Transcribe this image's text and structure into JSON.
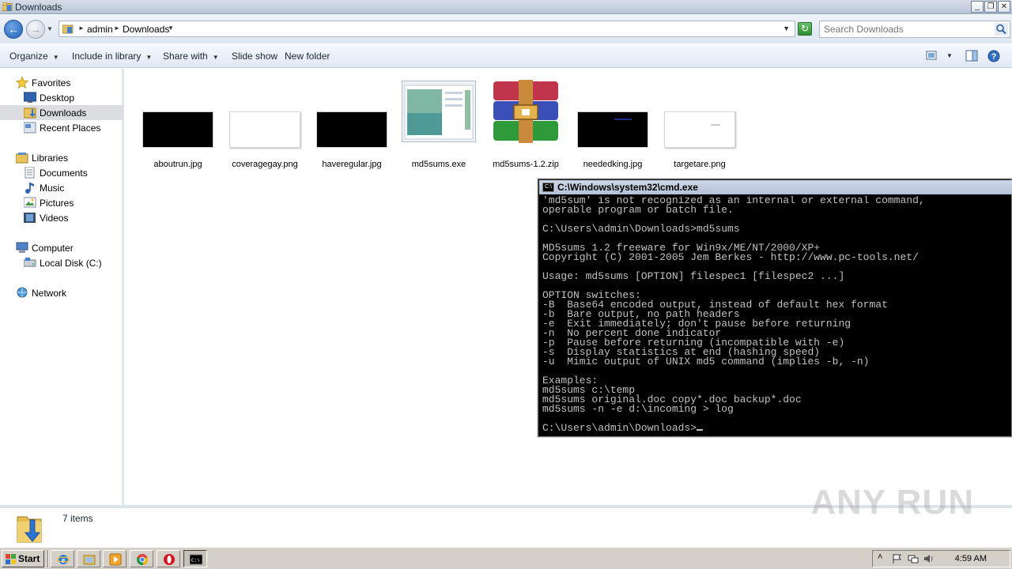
{
  "window": {
    "title": "Downloads",
    "buttons": {
      "minimize": "_",
      "restore": "❐",
      "close": "✕"
    }
  },
  "address": {
    "crumbs": [
      "admin",
      "Downloads"
    ],
    "search_placeholder": "Search Downloads"
  },
  "toolbar": {
    "organize": "Organize",
    "include_library": "Include in library",
    "share_with": "Share with",
    "slide_show": "Slide show",
    "new_folder": "New folder"
  },
  "nav": {
    "favorites": "Favorites",
    "desktop": "Desktop",
    "downloads": "Downloads",
    "recent_places": "Recent Places",
    "libraries": "Libraries",
    "documents": "Documents",
    "music": "Music",
    "pictures": "Pictures",
    "videos": "Videos",
    "computer": "Computer",
    "local_disk": "Local Disk (C:)",
    "network": "Network"
  },
  "files": [
    {
      "name": "aboutrun.jpg",
      "kind": "black-image"
    },
    {
      "name": "coveragegay.png",
      "kind": "white-image"
    },
    {
      "name": "haveregular.jpg",
      "kind": "black-image"
    },
    {
      "name": "md5sums.exe",
      "kind": "exe"
    },
    {
      "name": "md5sums-1.2.zip",
      "kind": "winrar-archive"
    },
    {
      "name": "neededking.jpg",
      "kind": "black-image"
    },
    {
      "name": "targetare.png",
      "kind": "white-image"
    }
  ],
  "status": {
    "item_count": "7 items"
  },
  "watermark": "ANY RUN",
  "cmd": {
    "title": "C:\\Windows\\system32\\cmd.exe",
    "lines": [
      "'md5sum' is not recognized as an internal or external command,",
      "operable program or batch file.",
      "",
      "C:\\Users\\admin\\Downloads>md5sums",
      "",
      "MD5sums 1.2 freeware for Win9x/ME/NT/2000/XP+",
      "Copyright (C) 2001-2005 Jem Berkes - http://www.pc-tools.net/",
      "",
      "Usage: md5sums [OPTION] filespec1 [filespec2 ...]",
      "",
      "OPTION switches:",
      "-B  Base64 encoded output, instead of default hex format",
      "-b  Bare output, no path headers",
      "-e  Exit immediately; don't pause before returning",
      "-n  No percent done indicator",
      "-p  Pause before returning (incompatible with -e)",
      "-s  Display statistics at end (hashing speed)",
      "-u  Mimic output of UNIX md5 command (implies -b, -n)",
      "",
      "Examples:",
      "md5sums c:\\temp",
      "md5sums original.doc copy*.doc backup*.doc",
      "md5sums -n -e d:\\incoming > log",
      ""
    ],
    "prompt": "C:\\Users\\admin\\Downloads>"
  },
  "taskbar": {
    "start": "Start",
    "clock": "4:59 AM"
  }
}
